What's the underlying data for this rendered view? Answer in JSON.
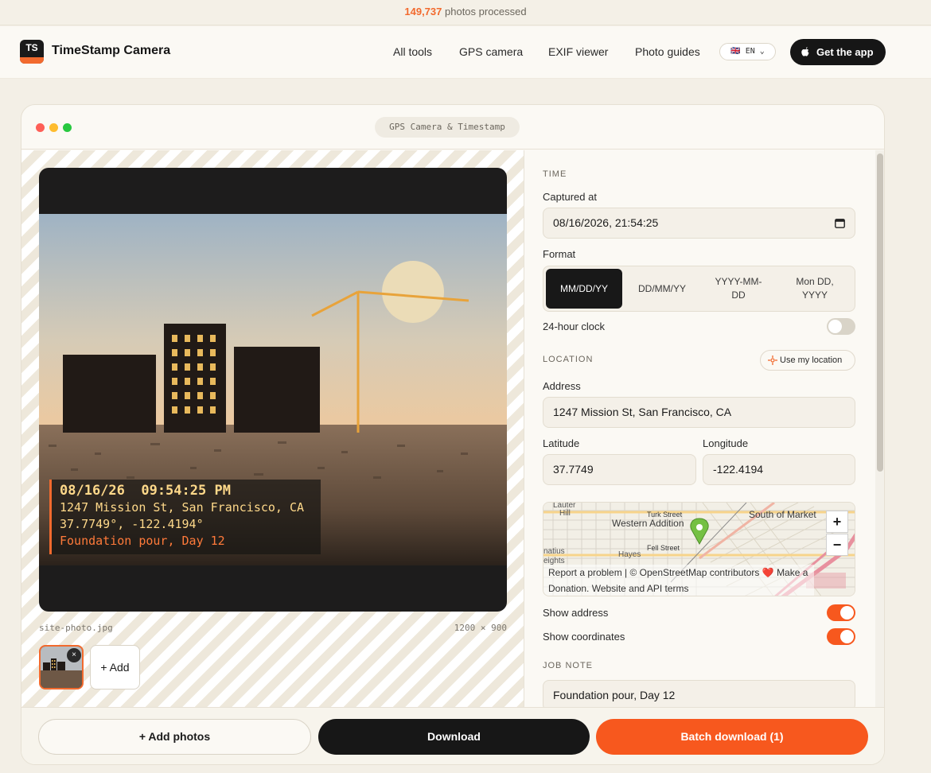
{
  "banner": {
    "count": "149,737",
    "text": "photos processed"
  },
  "nav": {
    "logo_text": "TS",
    "brand": "TimeStamp Camera",
    "links": [
      "All tools",
      "GPS camera",
      "EXIF viewer",
      "Photo guides"
    ],
    "language": "EN",
    "language_flag": "🇬🇧",
    "cta": "Get the app"
  },
  "window": {
    "title": "GPS Camera & Timestamp"
  },
  "photo": {
    "overlay": {
      "time": "08/16/26  09:54:25 PM",
      "address": "1247 Mission St, San Francisco, CA",
      "coords": "37.7749°, -122.4194°",
      "note": "Foundation pour, Day 12"
    },
    "filename": "site-photo.jpg",
    "dimensions": "1200 × 900",
    "thumb_close": "×",
    "add_label": "+ Add"
  },
  "settings": {
    "time": {
      "section": "TIME",
      "captured_label": "Captured at",
      "captured_value": "08/16/2026, 21:54:25",
      "format_label": "Format",
      "formats": [
        "MM/DD/YY",
        "DD/MM/YY",
        "YYYY-MM-DD",
        "Mon DD, YYYY"
      ],
      "selected_format": "MM/DD/YY",
      "clock_label": "24-hour clock",
      "clock_on": false
    },
    "location": {
      "section": "LOCATION",
      "use_location": "Use my location",
      "address_label": "Address",
      "address_value": "1247 Mission St, San Francisco, CA",
      "lat_label": "Latitude",
      "lat_value": "37.7749",
      "lon_label": "Longitude",
      "lon_value": "-122.4194",
      "map": {
        "labels": [
          "Western Addition",
          "South of Market",
          "Turk Street",
          "Fell Street",
          "Hayes",
          "Lauter",
          "Hill",
          "natius",
          "eights"
        ],
        "zoom_in": "+",
        "zoom_out": "−",
        "attribution_1": "Report a problem | © OpenStreetMap contributors",
        "heart": "❤️",
        "attribution_2": "Make a",
        "attribution_3": "Donation. Website and API terms"
      },
      "show_address_label": "Show address",
      "show_address_on": true,
      "show_coords_label": "Show coordinates",
      "show_coords_on": true
    },
    "job_note": {
      "section": "JOB NOTE",
      "value": "Foundation pour, Day 12"
    }
  },
  "footer": {
    "add_photos": "+ Add photos",
    "download": "Download",
    "batch_download": "Batch download (1)"
  },
  "colors": {
    "accent": "#f26a2e",
    "dark": "#171717",
    "background": "#f3efe6"
  }
}
